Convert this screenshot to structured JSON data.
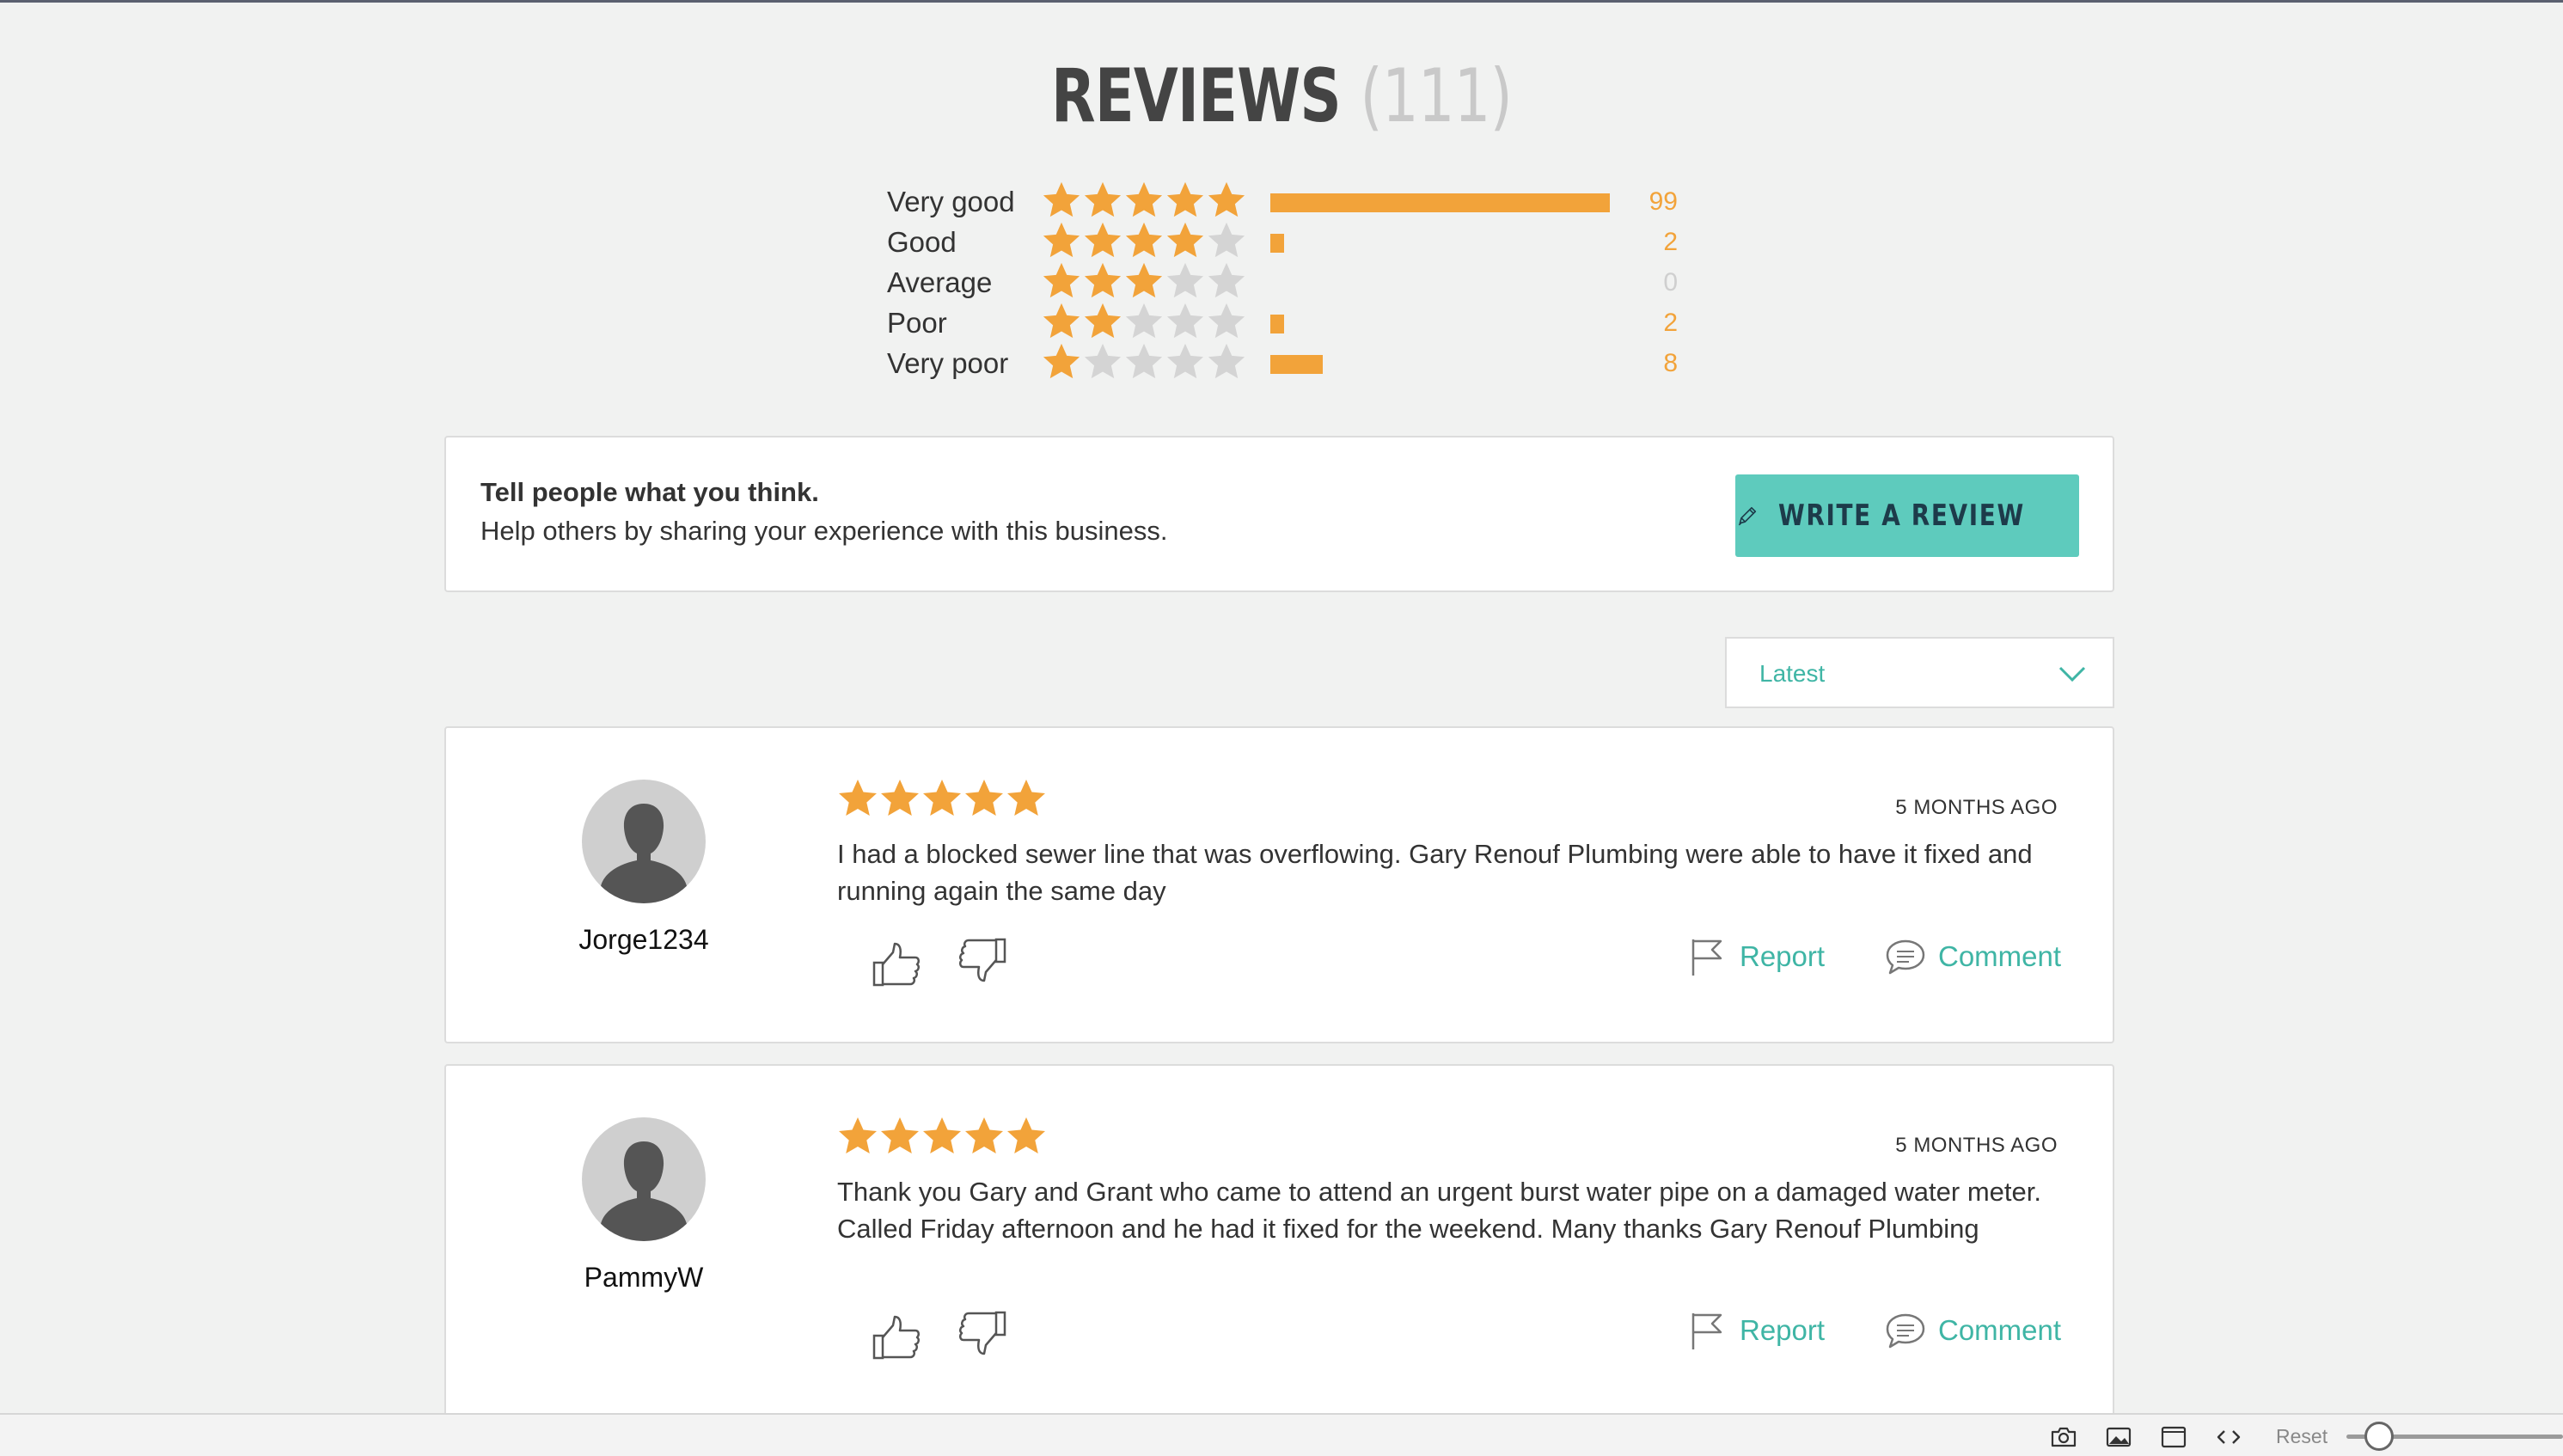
{
  "header": {
    "title": "REVIEWS",
    "count": "(111)"
  },
  "summary": {
    "rows": [
      {
        "label": "Very good",
        "stars": 5,
        "count": "99",
        "fraction": 0.485
      },
      {
        "label": "Good",
        "stars": 4,
        "count": "2",
        "fraction": 0.02
      },
      {
        "label": "Average",
        "stars": 3,
        "count": "0",
        "fraction": 0
      },
      {
        "label": "Poor",
        "stars": 2,
        "count": "2",
        "fraction": 0.02
      },
      {
        "label": "Very poor",
        "stars": 1,
        "count": "8",
        "fraction": 0.075
      }
    ]
  },
  "cta": {
    "heading": "Tell people what you think.",
    "subtext": "Help others by sharing your experience with this business.",
    "button_label": "WRITE A REVIEW"
  },
  "sort": {
    "selected": "Latest"
  },
  "reviews": [
    {
      "username": "Jorge1234",
      "stars": 5,
      "date": "5 MONTHS AGO",
      "text": "I had a blocked sewer line that was overflowing. Gary Renouf Plumbing were able to have it fixed and running again the same day",
      "report_label": "Report",
      "comment_label": "Comment"
    },
    {
      "username": "PammyW",
      "stars": 5,
      "date": "5 MONTHS AGO",
      "text": "Thank you Gary and Grant who came to attend an urgent burst water pipe on a damaged water meter. Called Friday afternoon and he had it fixed for the weekend. Many thanks Gary Renouf Plumbing",
      "report_label": "Report",
      "comment_label": "Comment"
    }
  ],
  "toolbar": {
    "reset_label": "Reset",
    "zoom_fraction": 0.15
  },
  "colors": {
    "star": "#f2a33a",
    "star_empty": "#d4d4d4",
    "accent": "#3fb5a5",
    "button": "#5ecbbd"
  },
  "icons": [
    "pencil-icon",
    "chevron-down-icon",
    "thumbs-up-icon",
    "thumbs-down-icon",
    "flag-icon",
    "comment-icon",
    "camera-icon",
    "image-icon",
    "frame-icon",
    "code-icon"
  ]
}
